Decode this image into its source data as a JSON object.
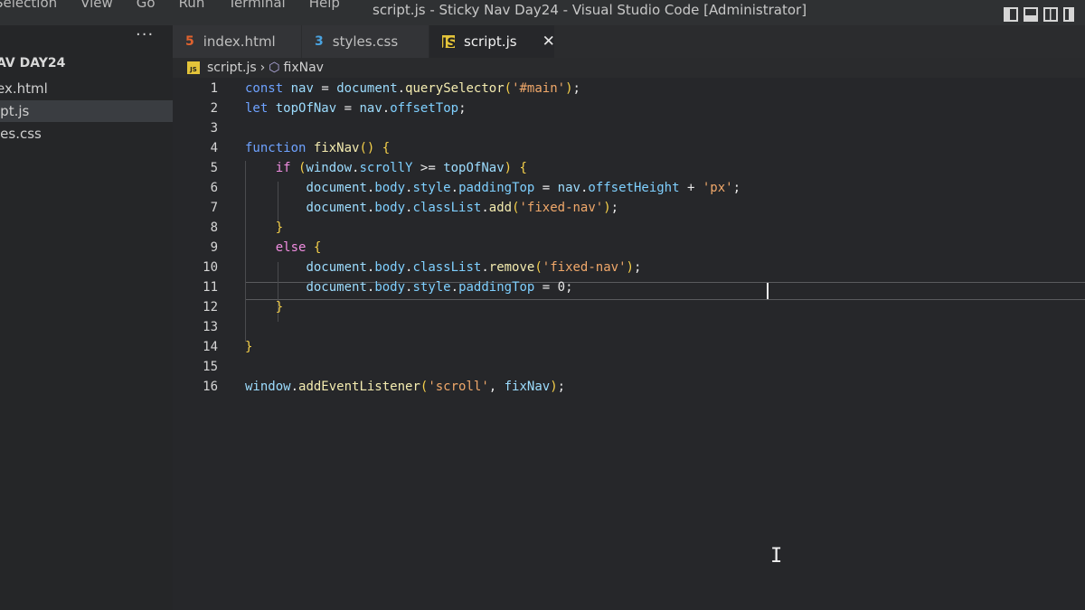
{
  "titlebar": {
    "menu": [
      "Selection",
      "View",
      "Go",
      "Run",
      "Terminal",
      "Help"
    ],
    "title": "script.js - Sticky Nav Day24 - Visual Studio Code [Administrator]"
  },
  "sidebar": {
    "more": "···",
    "folder": "AV DAY24",
    "files": [
      {
        "label": "ex.html",
        "active": false
      },
      {
        "label": "ipt.js",
        "active": true
      },
      {
        "label": "les.css",
        "active": false
      }
    ]
  },
  "tabs": [
    {
      "label": "index.html",
      "icon": "html5-icon"
    },
    {
      "label": "styles.css",
      "icon": "css3-icon"
    },
    {
      "label": "script.js",
      "icon": "js-icon",
      "active": true
    }
  ],
  "tab_icon_text": {
    "html": "5",
    "css": "3",
    "js": "JS"
  },
  "tab_close": "✕",
  "breadcrumb": {
    "file": "script.js",
    "symbol": "fixNav"
  },
  "line_numbers": [
    "1",
    "2",
    "3",
    "4",
    "5",
    "6",
    "7",
    "8",
    "9",
    "10",
    "11",
    "12",
    "13",
    "14",
    "15",
    "16"
  ],
  "code_lines": [
    "const nav = document.querySelector('#main');",
    "let topOfNav = nav.offsetTop;",
    "",
    "function fixNav() {",
    "    if (window.scrollY >= topOfNav) {",
    "        document.body.style.paddingTop = nav.offsetHeight + 'px';",
    "        document.body.classList.add('fixed-nav');",
    "    }",
    "    else {",
    "        document.body.classList.remove('fixed-nav');",
    "        document.body.style.paddingTop = 0;",
    "    }",
    "",
    "}",
    "",
    "window.addEventListener('scroll', fixNav);"
  ],
  "cursor_icon": "I",
  "colors": {
    "editor_bg": "#26272a",
    "sidebar_bg": "#252628",
    "keyword": "#6ea2ff",
    "string": "#f0a86a",
    "bracket": "#f7d14a"
  }
}
